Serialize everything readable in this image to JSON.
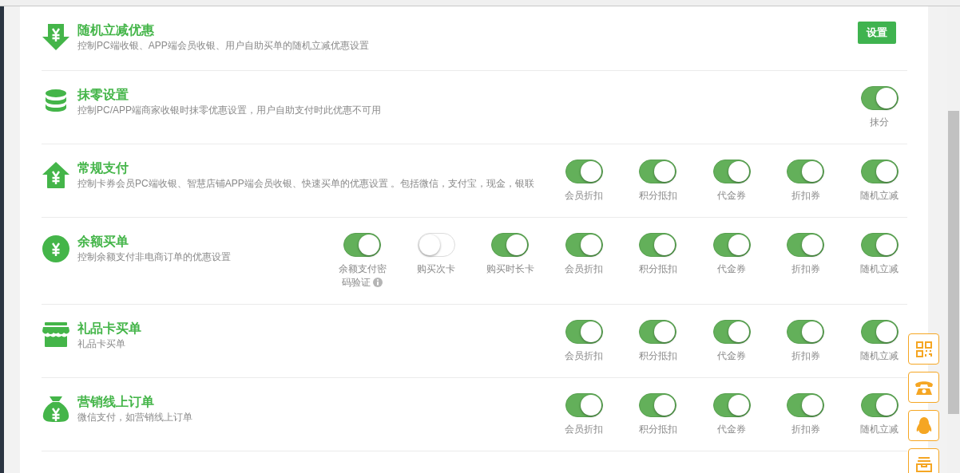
{
  "rows": [
    {
      "kind": "button",
      "title": "随机立减优惠",
      "description": "控制PC端收银、APP端会员收银、用户自助买单的随机立减优惠设置",
      "button": "设置"
    },
    {
      "kind": "switches",
      "title": "抹零设置",
      "description": "控制PC/APP端商家收银时抹零优惠设置，用户自助支付时此优惠不可用",
      "switches": [
        {
          "label": "抹分",
          "on": true
        }
      ]
    },
    {
      "kind": "switches",
      "title": "常规支付",
      "description": "控制卡券会员PC端收银、智慧店铺APP端会员收银、快速买单的优惠设置 。包括微信，支付宝，现金，银联",
      "switches": [
        {
          "label": "会员折扣",
          "on": true
        },
        {
          "label": "积分抵扣",
          "on": true
        },
        {
          "label": "代金券",
          "on": true
        },
        {
          "label": "折扣券",
          "on": true
        },
        {
          "label": "随机立减",
          "on": true
        }
      ]
    },
    {
      "kind": "switches",
      "title": "余额买单",
      "description": "控制余额支付非电商订单的优惠设置",
      "switches": [
        {
          "label": "余额支付密码验证",
          "on": true,
          "info_icon": true
        },
        {
          "label": "购买次卡",
          "on": false
        },
        {
          "label": "购买时长卡",
          "on": true
        },
        {
          "label": "会员折扣",
          "on": true
        },
        {
          "label": "积分抵扣",
          "on": true
        },
        {
          "label": "代金券",
          "on": true
        },
        {
          "label": "折扣券",
          "on": true
        },
        {
          "label": "随机立减",
          "on": true
        }
      ]
    },
    {
      "kind": "switches",
      "title": "礼品卡买单",
      "description": "礼品卡买单",
      "switches": [
        {
          "label": "会员折扣",
          "on": true
        },
        {
          "label": "积分抵扣",
          "on": true
        },
        {
          "label": "代金券",
          "on": true
        },
        {
          "label": "折扣券",
          "on": true
        },
        {
          "label": "随机立减",
          "on": true
        }
      ]
    },
    {
      "kind": "switches",
      "title": "营销线上订单",
      "description": "微信支付，如营销线上订单",
      "switches": [
        {
          "label": "会员折扣",
          "on": true
        },
        {
          "label": "积分抵扣",
          "on": true
        },
        {
          "label": "代金券",
          "on": true
        },
        {
          "label": "折扣券",
          "on": true
        },
        {
          "label": "随机立减",
          "on": true
        }
      ]
    }
  ]
}
